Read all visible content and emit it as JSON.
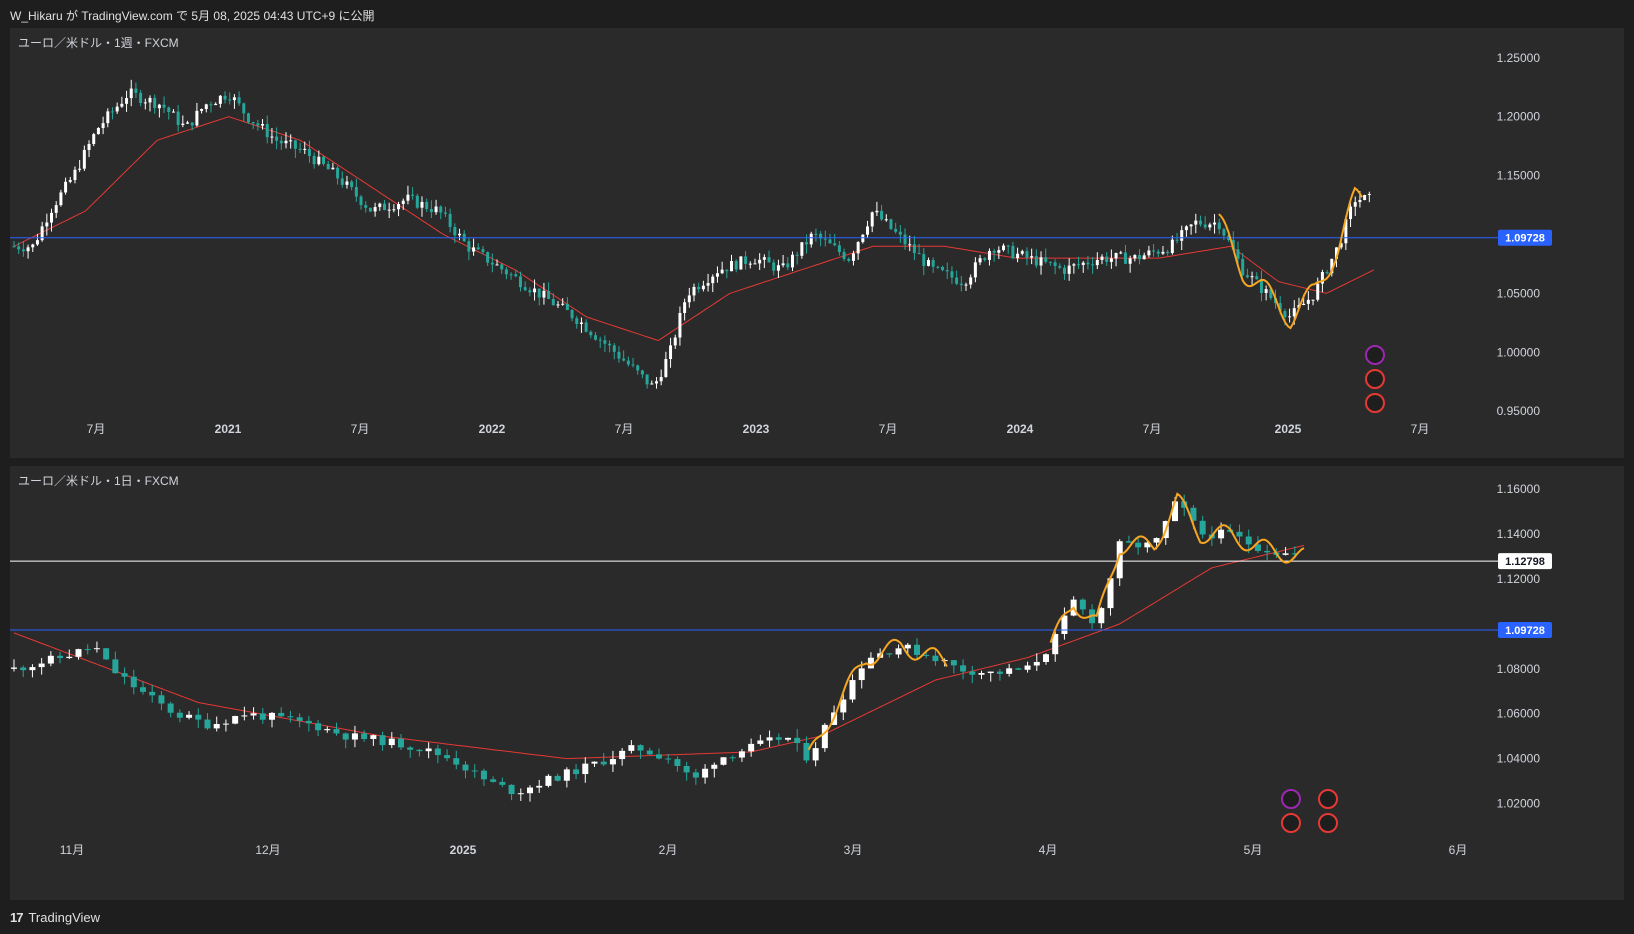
{
  "header": {
    "publish_text": "W_Hikaru が TradingView.com で 5月 08, 2025 04:43 UTC+9 に公開"
  },
  "pane_top": {
    "title": "ユーロ／米ドル・1週・FXCM",
    "price_labels": [
      "1.25000",
      "1.20000",
      "1.15000",
      "1.05000",
      "1.00000",
      "0.95000"
    ],
    "price_values": [
      1.25,
      1.2,
      1.15,
      1.05,
      1.0,
      0.95
    ],
    "hline_label": "1.09728",
    "hline_value": 1.09728,
    "time_labels": [
      "7月",
      "2021",
      "7月",
      "2022",
      "7月",
      "2023",
      "7月",
      "2024",
      "7月",
      "2025",
      "7月"
    ]
  },
  "pane_bottom": {
    "title": "ユーロ／米ドル・1日・FXCM",
    "price_labels": [
      "1.16000",
      "1.14000",
      "1.12000",
      "1.08000",
      "1.06000",
      "1.04000",
      "1.02000"
    ],
    "price_values": [
      1.16,
      1.14,
      1.12,
      1.08,
      1.06,
      1.04,
      1.02
    ],
    "current_label": "1.12798",
    "current_value": 1.12798,
    "hline_label": "1.09728",
    "hline_value": 1.09728,
    "time_labels": [
      "11月",
      "12月",
      "2025",
      "2月",
      "3月",
      "4月",
      "5月",
      "6月"
    ]
  },
  "colors": {
    "bull": "#ffffff",
    "bear": "#26a69a",
    "ma": "#e53935",
    "hline": "#2962ff",
    "drawing": "#f5a623",
    "background": "#2a2a2a"
  },
  "footer": {
    "brand": "TradingView",
    "logo_icon": "tradingview-logo-icon"
  },
  "chart_data": [
    {
      "type": "candlestick",
      "title": "ユーロ／米ドル・1週・FXCM",
      "ylim": [
        0.94,
        1.26
      ],
      "close_series": [
        [
          0,
          1.09
        ],
        [
          8,
          1.09
        ],
        [
          15,
          1.12
        ],
        [
          25,
          1.15
        ],
        [
          35,
          1.19
        ],
        [
          48,
          1.22
        ],
        [
          62,
          1.21
        ],
        [
          72,
          1.19
        ],
        [
          80,
          1.21
        ],
        [
          90,
          1.22
        ],
        [
          98,
          1.2
        ],
        [
          110,
          1.18
        ],
        [
          122,
          1.17
        ],
        [
          135,
          1.15
        ],
        [
          150,
          1.12
        ],
        [
          165,
          1.13
        ],
        [
          178,
          1.12
        ],
        [
          190,
          1.09
        ],
        [
          205,
          1.07
        ],
        [
          220,
          1.05
        ],
        [
          235,
          1.03
        ],
        [
          252,
          1.0
        ],
        [
          268,
          0.97
        ],
        [
          275,
          1.0
        ],
        [
          282,
          1.05
        ],
        [
          295,
          1.07
        ],
        [
          310,
          1.08
        ],
        [
          322,
          1.07
        ],
        [
          335,
          1.1
        ],
        [
          350,
          1.08
        ],
        [
          360,
          1.12
        ],
        [
          370,
          1.1
        ],
        [
          385,
          1.07
        ],
        [
          398,
          1.06
        ],
        [
          410,
          1.09
        ],
        [
          425,
          1.08
        ],
        [
          440,
          1.07
        ],
        [
          455,
          1.08
        ],
        [
          470,
          1.08
        ],
        [
          485,
          1.09
        ],
        [
          495,
          1.11
        ],
        [
          505,
          1.11
        ],
        [
          515,
          1.07
        ],
        [
          525,
          1.05
        ],
        [
          535,
          1.03
        ],
        [
          545,
          1.05
        ],
        [
          555,
          1.09
        ],
        [
          562,
          1.13
        ],
        [
          570,
          1.13
        ]
      ],
      "ma_series": [
        [
          0,
          1.09
        ],
        [
          30,
          1.12
        ],
        [
          60,
          1.18
        ],
        [
          90,
          1.2
        ],
        [
          120,
          1.18
        ],
        [
          150,
          1.14
        ],
        [
          180,
          1.1
        ],
        [
          210,
          1.07
        ],
        [
          240,
          1.03
        ],
        [
          270,
          1.01
        ],
        [
          300,
          1.05
        ],
        [
          330,
          1.07
        ],
        [
          360,
          1.09
        ],
        [
          390,
          1.09
        ],
        [
          420,
          1.08
        ],
        [
          450,
          1.08
        ],
        [
          480,
          1.08
        ],
        [
          510,
          1.09
        ],
        [
          530,
          1.06
        ],
        [
          550,
          1.05
        ],
        [
          570,
          1.07
        ]
      ],
      "hlines": [
        {
          "value": 1.09728,
          "label": "1.09728"
        }
      ]
    },
    {
      "type": "candlestick",
      "title": "ユーロ／米ドル・1日・FXCM",
      "ylim": [
        1.01,
        1.165
      ],
      "close_series": [
        [
          0,
          1.08
        ],
        [
          20,
          1.085
        ],
        [
          35,
          1.09
        ],
        [
          42,
          1.08
        ],
        [
          55,
          1.07
        ],
        [
          70,
          1.06
        ],
        [
          85,
          1.055
        ],
        [
          100,
          1.06
        ],
        [
          115,
          1.058
        ],
        [
          130,
          1.055
        ],
        [
          145,
          1.05
        ],
        [
          160,
          1.048
        ],
        [
          175,
          1.045
        ],
        [
          190,
          1.04
        ],
        [
          205,
          1.03
        ],
        [
          218,
          1.025
        ],
        [
          230,
          1.03
        ],
        [
          245,
          1.035
        ],
        [
          258,
          1.04
        ],
        [
          270,
          1.045
        ],
        [
          285,
          1.04
        ],
        [
          295,
          1.03
        ],
        [
          305,
          1.04
        ],
        [
          320,
          1.045
        ],
        [
          335,
          1.05
        ],
        [
          345,
          1.04
        ],
        [
          355,
          1.06
        ],
        [
          370,
          1.085
        ],
        [
          385,
          1.09
        ],
        [
          400,
          1.085
        ],
        [
          410,
          1.08
        ],
        [
          425,
          1.078
        ],
        [
          440,
          1.08
        ],
        [
          450,
          1.09
        ],
        [
          460,
          1.11
        ],
        [
          470,
          1.1
        ],
        [
          480,
          1.135
        ],
        [
          495,
          1.135
        ],
        [
          505,
          1.155
        ],
        [
          515,
          1.14
        ],
        [
          528,
          1.14
        ],
        [
          538,
          1.135
        ],
        [
          548,
          1.132
        ],
        [
          560,
          1.13
        ]
      ],
      "ma_series": [
        [
          0,
          1.096
        ],
        [
          80,
          1.065
        ],
        [
          160,
          1.05
        ],
        [
          240,
          1.04
        ],
        [
          320,
          1.043
        ],
        [
          350,
          1.05
        ],
        [
          400,
          1.075
        ],
        [
          440,
          1.085
        ],
        [
          480,
          1.1
        ],
        [
          520,
          1.125
        ],
        [
          560,
          1.135
        ]
      ],
      "hlines": [
        {
          "value": 1.09728,
          "label": "1.09728"
        },
        {
          "value": 1.12798,
          "label": "1.12798"
        }
      ]
    }
  ]
}
